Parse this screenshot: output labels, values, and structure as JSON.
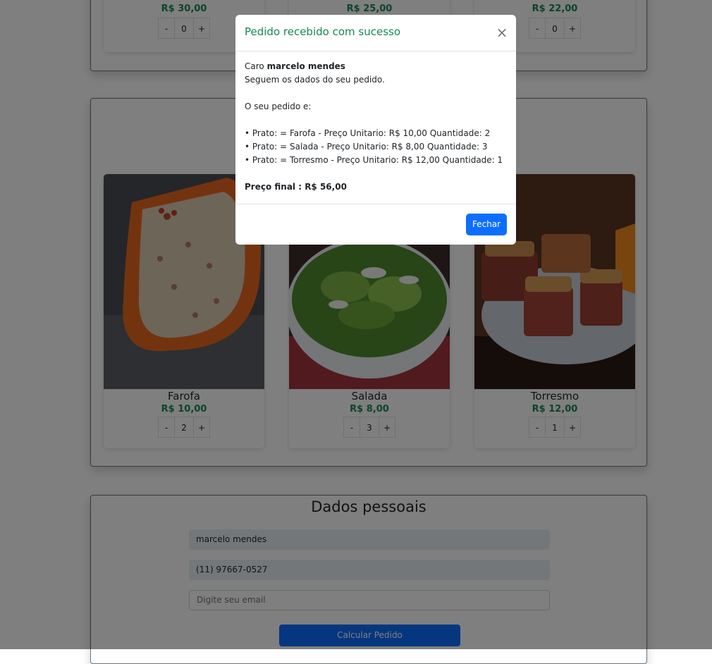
{
  "top_row": {
    "prices": [
      "R$ 30,00",
      "R$ 25,00",
      "R$ 22,00"
    ],
    "quantities": [
      "0",
      "0",
      "0"
    ]
  },
  "dishes": [
    {
      "name": "Farofa",
      "price": "R$ 10,00",
      "qty": "2"
    },
    {
      "name": "Salada",
      "price": "R$ 8,00",
      "qty": "3"
    },
    {
      "name": "Torresmo",
      "price": "R$ 12,00",
      "qty": "1"
    }
  ],
  "stepper": {
    "minus": "-",
    "plus": "+"
  },
  "dados": {
    "title": "Dados pessoais",
    "name_value": "marcelo mendes",
    "phone_value": "(11) 97667-0527",
    "email_placeholder": "Digite seu email",
    "calc_button": "Calcular Pedido"
  },
  "modal": {
    "title": "Pedido recebido com sucesso",
    "close_symbol": "×",
    "greeting_prefix": "Caro",
    "customer_name": "marcelo mendes",
    "intro": "Seguem os dados do seu pedido.",
    "order_label": "O seu pedido e:",
    "items": [
      "• Prato: = Farofa - Preço Unitario: R$ 10,00 Quantidade: 2",
      "• Prato: = Salada - Preço Unitario: R$ 8,00 Quantidade: 3",
      "• Prato: = Torresmo - Preço Unitario: R$ 12,00 Quantidade: 1"
    ],
    "total_label": "Preço final : R$ 56,00",
    "close_button": "Fechar"
  },
  "colors": {
    "price_green": "#198754",
    "primary_blue": "#0d6efd"
  }
}
